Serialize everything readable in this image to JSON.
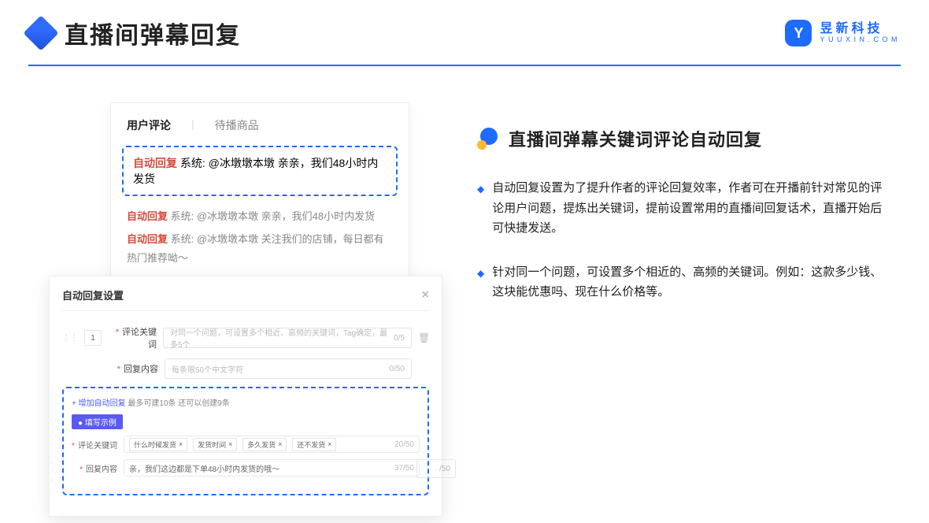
{
  "header": {
    "title": "直播间弹幕回复",
    "brand_cn": "昱新科技",
    "brand_en": "YUUXIN.COM",
    "brand_mark": "Y"
  },
  "comment_card": {
    "tab1": "用户评论",
    "tab2": "待播商品",
    "highlight_tag": "自动回复",
    "highlight_text": " 系统: @冰墩墩本墩 亲亲，我们48小时内发货",
    "msg2_tag": "自动回复",
    "msg2_text": " 系统: @冰墩墩本墩 亲亲，我们48小时内发货",
    "msg3_tag": "自动回复",
    "msg3_text": " 系统: @冰墩墩本墩 关注我们的店铺，每日都有热门推荐呦～"
  },
  "settings": {
    "title": "自动回复设置",
    "index": "1",
    "field1_label": "评论关键词",
    "field1_placeholder": "对同一个问题，可设置多个相近、高频的关键词，Tag确定，最多5个",
    "field1_count": "0/5",
    "field2_label": "回复内容",
    "field2_placeholder": "每条限50个中文字符",
    "field2_count": "0/50",
    "add_link": "+ 增加自动回复",
    "add_hint": " 最多可建10条 还可以创建9条",
    "pill": "● 填写示例",
    "ex1_label": "评论关键词",
    "ex1_chip1": "什么时候发货",
    "ex1_chip2": "发货时间",
    "ex1_chip3": "多久发货",
    "ex1_chip4": "还不发货",
    "ex1_count": "20/50",
    "ex2_label": "回复内容",
    "ex2_text": "亲，我们这边都是下单48小时内发货的哦～",
    "ex2_count": "37/50",
    "footer_count": "/50"
  },
  "right": {
    "section_title": "直播间弹幕关键词评论自动回复",
    "bullet1": "自动回复设置为了提升作者的评论回复效率，作者可在开播前针对常见的评论用户问题，提炼出关键词，提前设置常用的直播间回复话术，直播开始后可快捷发送。",
    "bullet2": "针对同一个问题，可设置多个相近的、高频的关键词。例如：这款多少钱、这块能优惠吗、现在什么价格等。"
  }
}
